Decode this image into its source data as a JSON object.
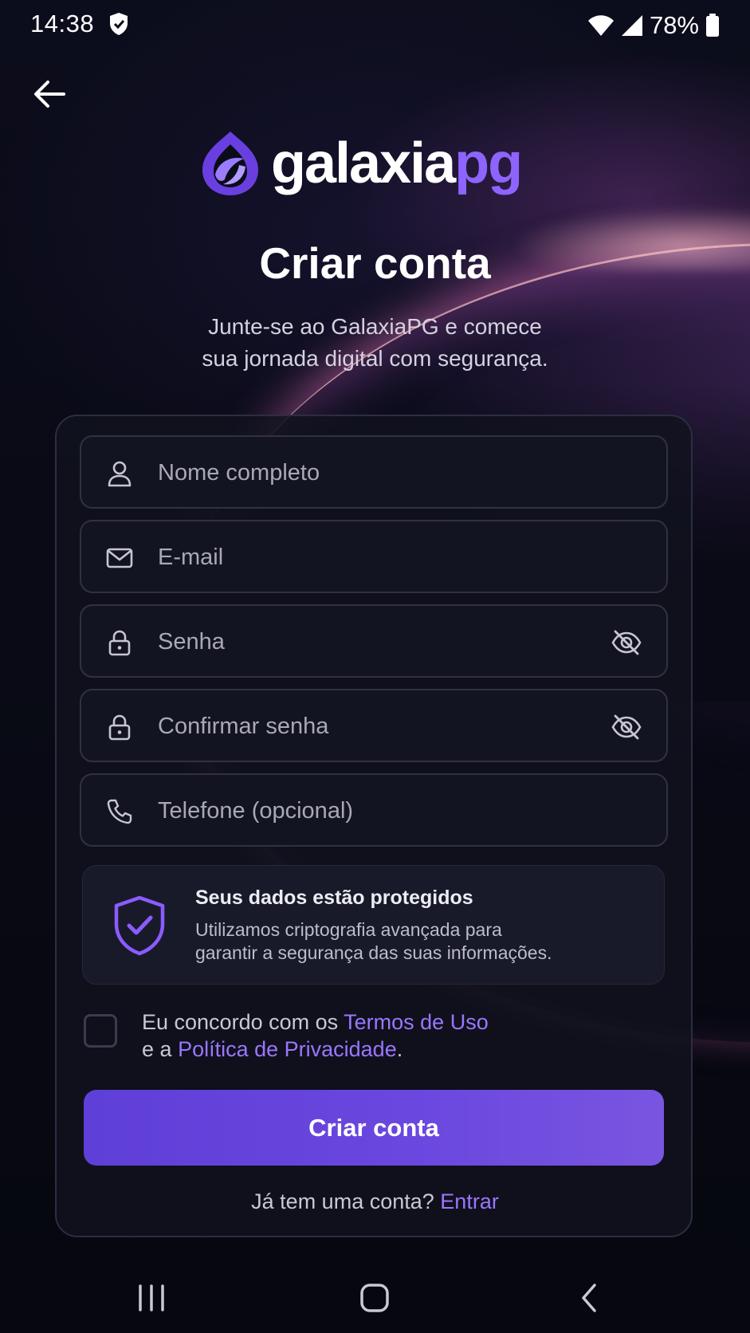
{
  "status": {
    "time": "14:38",
    "battery": "78%",
    "icons": [
      "shield-icon",
      "wifi-icon",
      "signal-icon",
      "battery-icon"
    ]
  },
  "header": {
    "back_icon": "arrow-left-icon",
    "logo_word": "galaxia",
    "logo_accent": "pg",
    "title": "Criar conta",
    "subtitle_line1": "Junte-se ao GalaxiaPG e comece",
    "subtitle_line2": "sua jornada digital com segurança."
  },
  "form": {
    "name": {
      "placeholder": "Nome completo",
      "icon": "user-icon",
      "value": ""
    },
    "email": {
      "placeholder": "E-mail",
      "icon": "mail-icon",
      "value": ""
    },
    "password": {
      "placeholder": "Senha",
      "icon": "lock-icon",
      "toggle_icon": "eye-off-icon",
      "value": ""
    },
    "confirm_password": {
      "placeholder": "Confirmar senha",
      "icon": "lock-icon",
      "toggle_icon": "eye-off-icon",
      "value": ""
    },
    "phone": {
      "placeholder": "Telefone (opcional)",
      "icon": "phone-icon",
      "value": ""
    }
  },
  "security": {
    "icon": "shield-check-icon",
    "title": "Seus dados estão protegidos",
    "text_line1": "Utilizamos criptografia avançada para",
    "text_line2": "garantir a segurança das suas informações."
  },
  "terms": {
    "checked": false,
    "prefix": "Eu concordo com os",
    "terms_link": "Termos de Uso",
    "middle": "e a",
    "privacy_link": "Política de Privacidade",
    "suffix": "."
  },
  "submit_label": "Criar conta",
  "login": {
    "question": "Já tem uma conta?",
    "link": "Entrar"
  },
  "colors": {
    "accent": "#8e64ff",
    "button_start": "#5e3fd7",
    "button_end": "#7a55e0",
    "background": "#0a0b16"
  },
  "navbar": {
    "icons": [
      "recent-apps-icon",
      "home-icon",
      "back-icon"
    ]
  }
}
